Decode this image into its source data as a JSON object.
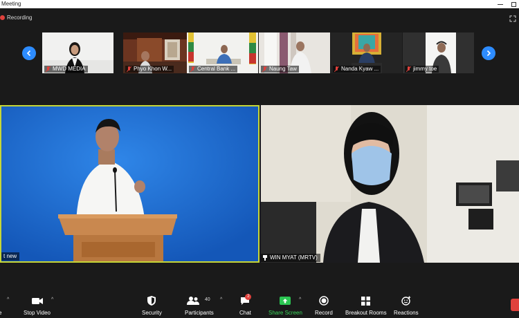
{
  "window": {
    "title": "Meeting"
  },
  "recording": {
    "label": "Recording"
  },
  "thumbnails": [
    {
      "name": "MWD MEDIA"
    },
    {
      "name": "Phyo Khon W..."
    },
    {
      "name": "Central Bank ..."
    },
    {
      "name": "Naung Taw"
    },
    {
      "name": "Nanda Kyaw ..."
    },
    {
      "name": "jimmy toe"
    }
  ],
  "main_videos": {
    "left": {
      "name": "t new"
    },
    "right": {
      "name": "WIN MYAT (MRTV)"
    }
  },
  "toolbar": {
    "stop_video": "Stop Video",
    "security": "Security",
    "participants": "Participants",
    "participants_count": "40",
    "chat": "Chat",
    "chat_badge": "2",
    "share_screen": "Share Screen",
    "record": "Record",
    "breakout_rooms": "Breakout Rooms",
    "reactions": "Reactions",
    "left_partial": "e"
  },
  "colors": {
    "accent": "#2d8cff",
    "active_speaker": "#c6d636",
    "share": "#3bd55a",
    "alert": "#e0413c"
  }
}
